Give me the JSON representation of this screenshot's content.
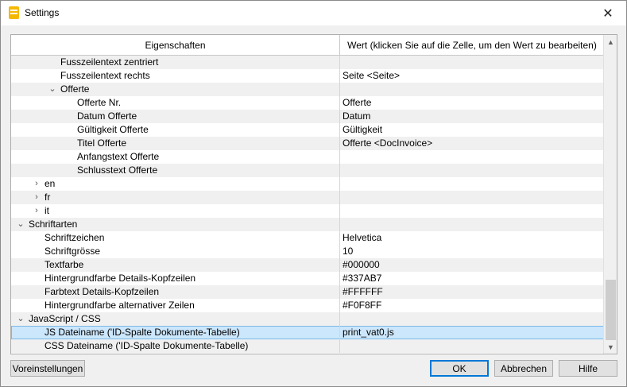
{
  "window": {
    "title": "Settings"
  },
  "grid": {
    "columns": [
      "Eigenschaften",
      "Wert (klicken Sie auf die Zelle, um den Wert zu bearbeiten)"
    ],
    "rows": [
      {
        "label": "Fusszeilentext zentriert",
        "value": ""
      },
      {
        "label": "Fusszeilentext rechts",
        "value": "Seite <Seite>"
      },
      {
        "label": "Offerte",
        "value": "",
        "toggle": "expanded"
      },
      {
        "label": "Offerte Nr.",
        "value": "Offerte"
      },
      {
        "label": "Datum Offerte",
        "value": "Datum"
      },
      {
        "label": "Gültigkeit Offerte",
        "value": "Gültigkeit"
      },
      {
        "label": "Titel Offerte",
        "value": "Offerte <DocInvoice>"
      },
      {
        "label": "Anfangstext Offerte",
        "value": ""
      },
      {
        "label": "Schlusstext Offerte",
        "value": ""
      },
      {
        "label": "en",
        "value": "",
        "toggle": "collapsed"
      },
      {
        "label": "fr",
        "value": "",
        "toggle": "collapsed"
      },
      {
        "label": "it",
        "value": "",
        "toggle": "collapsed"
      },
      {
        "label": "Schriftarten",
        "value": "",
        "toggle": "expanded"
      },
      {
        "label": "Schriftzeichen",
        "value": "Helvetica"
      },
      {
        "label": "Schriftgrösse",
        "value": "10"
      },
      {
        "label": "Textfarbe",
        "value": "#000000"
      },
      {
        "label": "Hintergrundfarbe Details-Kopfzeilen",
        "value": "#337AB7"
      },
      {
        "label": "Farbtext Details-Kopfzeilen",
        "value": "#FFFFFF"
      },
      {
        "label": "Hintergrundfarbe alternativer Zeilen",
        "value": "#F0F8FF"
      },
      {
        "label": "JavaScript / CSS",
        "value": "",
        "toggle": "expanded"
      },
      {
        "label": "JS Dateiname ('ID-Spalte Dokumente-Tabelle)",
        "value": "print_vat0.js",
        "selected": true
      },
      {
        "label": "CSS Dateiname ('ID-Spalte Dokumente-Tabelle)",
        "value": ""
      }
    ]
  },
  "buttons": {
    "defaults": "Voreinstellungen",
    "ok": "OK",
    "cancel": "Abbrechen",
    "help": "Hilfe"
  },
  "colors": {
    "selection": "#cce6fb",
    "default_button_border": "#0078d7",
    "app_icon": "#f5b800"
  }
}
